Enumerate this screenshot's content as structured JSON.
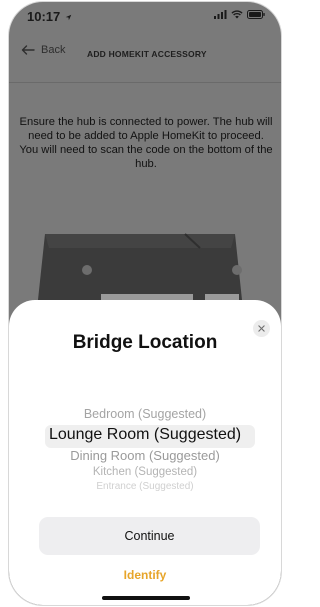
{
  "status_bar": {
    "time": "10:17",
    "location_icon": "location-arrow-icon",
    "signal_icon": "cellular-signal-icon",
    "wifi_icon": "wifi-icon",
    "battery_icon": "battery-icon"
  },
  "nav": {
    "back_label": "Back",
    "title": "ADD HOMEKIT ACCESSORY"
  },
  "instructions": "Ensure the hub is connected to power. The hub will need to be added to Apple HomeKit to proceed. You will need to scan the code on the bottom of the hub.",
  "sheet": {
    "title": "Bridge Location",
    "picker": {
      "options": [
        "Bedroom (Suggested)",
        "Lounge Room (Suggested)",
        "Dining Room (Suggested)",
        "Kitchen (Suggested)",
        "Entrance (Suggested)"
      ],
      "selected": "Lounge Room (Suggested)"
    },
    "continue_label": "Continue",
    "identify_label": "Identify"
  },
  "colors": {
    "accent": "#e7a52a",
    "dim_overlay": "#7a7a7a",
    "button_bg": "#eeeef0"
  }
}
